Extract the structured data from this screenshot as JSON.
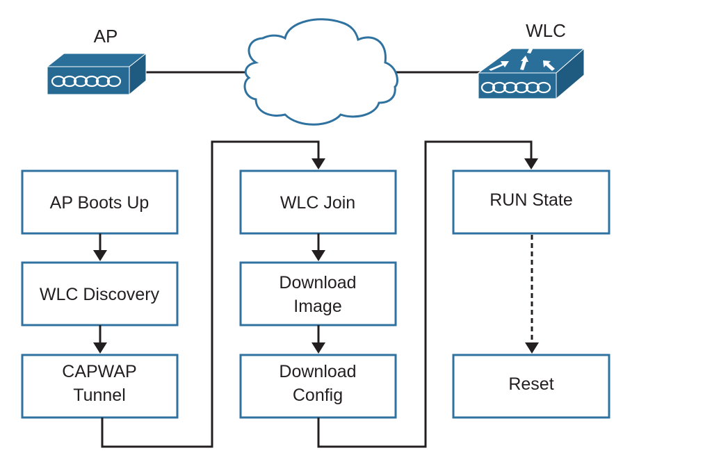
{
  "devices": {
    "ap": {
      "label": "AP",
      "icon": "access-point-icon"
    },
    "cloud": {
      "icon": "network-cloud-icon"
    },
    "wlc": {
      "label": "WLC",
      "icon": "wireless-lan-controller-icon"
    }
  },
  "colors": {
    "box_border": "#2f72a0",
    "device_blue": "#2a6f99",
    "connector": "#231f20",
    "text": "#231f20"
  },
  "flow": {
    "column1": [
      {
        "line1": "AP Boots Up",
        "line2": ""
      },
      {
        "line1": "WLC Discovery",
        "line2": ""
      },
      {
        "line1": "CAPWAP",
        "line2": "Tunnel"
      }
    ],
    "column2": [
      {
        "line1": "WLC Join",
        "line2": ""
      },
      {
        "line1": "Download",
        "line2": "Image"
      },
      {
        "line1": "Download",
        "line2": "Config"
      }
    ],
    "column3": [
      {
        "line1": "RUN State",
        "line2": ""
      },
      {
        "line1": "Reset",
        "line2": ""
      }
    ]
  }
}
